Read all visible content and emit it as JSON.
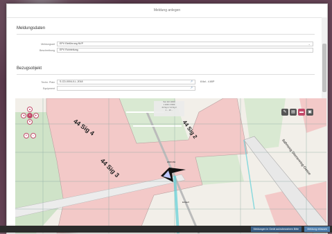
{
  "modal": {
    "title": "Meldung anlegen"
  },
  "meldungsdaten": {
    "heading": "Meldungsdaten",
    "meldungsart_label": "Meldungsart",
    "meldungsart_value": "EPV Einführung NVP",
    "beschreibung_label": "Beschreibung",
    "beschreibung_value": "EPV Rohrleitung"
  },
  "bezugsobjekt": {
    "heading": "Bezugsobjekt",
    "techn_platz_label": "Techn. Platz",
    "techn_platz_value": "S-CD-0004-0-L-2018",
    "techn_platz_coord": "8.6ul - 4.80P",
    "equipment_label": "Equipment",
    "equipment_value": ""
  },
  "map": {
    "info_line1": "Text 110 10000",
    "info_line2": "1 1000 1 5000",
    "info_line3": "44 Sig 2 / 14 Sig 3",
    "info_line4": "1 ... 16 ...",
    "label_sig4": "44 Sig 4",
    "label_sig2": "44 Sig 2",
    "label_sig3": "44 Sig 3",
    "label_street": "Bahnweg Sternenring-Gasse",
    "label_marker": "2000 MH",
    "label_small": "Einlaufr"
  },
  "footer": {
    "primary_label": "Meldung erfassen",
    "secondary_label": "Meldungen in Gerät aufzubewahren Bitte"
  },
  "colors": {
    "accent": "#c24a6a",
    "bottom_bar": "#2b2b2b",
    "primary_button": "#4f7fae"
  },
  "icons": [
    "zoom-in-icon",
    "zoom-out-icon",
    "pan-up-icon",
    "pan-down-icon",
    "pan-left-icon",
    "pan-right-icon",
    "ruler-icon",
    "layers-icon",
    "comment-icon",
    "print-icon",
    "dropdown-icon",
    "external-link-icon"
  ]
}
